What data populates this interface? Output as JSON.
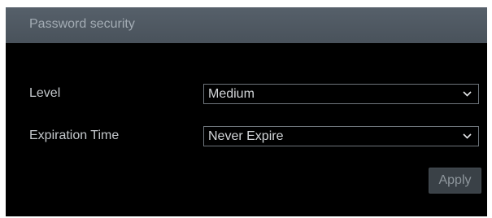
{
  "header": {
    "title": "Password security"
  },
  "form": {
    "level": {
      "label": "Level",
      "value": "Medium"
    },
    "expiration": {
      "label": "Expiration Time",
      "value": "Never Expire"
    }
  },
  "actions": {
    "apply_label": "Apply"
  },
  "icons": {
    "dropdown": "chevron-down-icon"
  },
  "colors": {
    "header_bg": "#525b64",
    "panel_bg": "#000000",
    "button_bg": "#3a4147"
  }
}
